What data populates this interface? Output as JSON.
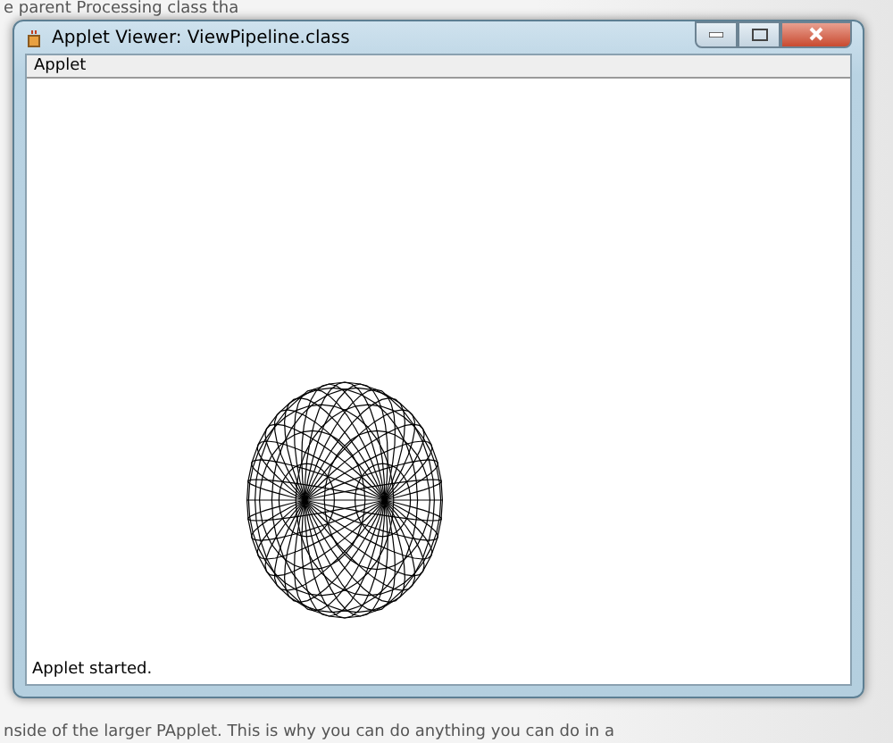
{
  "background_page": {
    "lines": [
      "e parent Processing class tha",
      "nside of the larger PApplet. This is why you can do anything you can do in a"
    ]
  },
  "window": {
    "title": "Applet Viewer: ViewPipeline.class"
  },
  "menu_bar": [
    "Applet"
  ],
  "status_bar": "Applet started."
}
